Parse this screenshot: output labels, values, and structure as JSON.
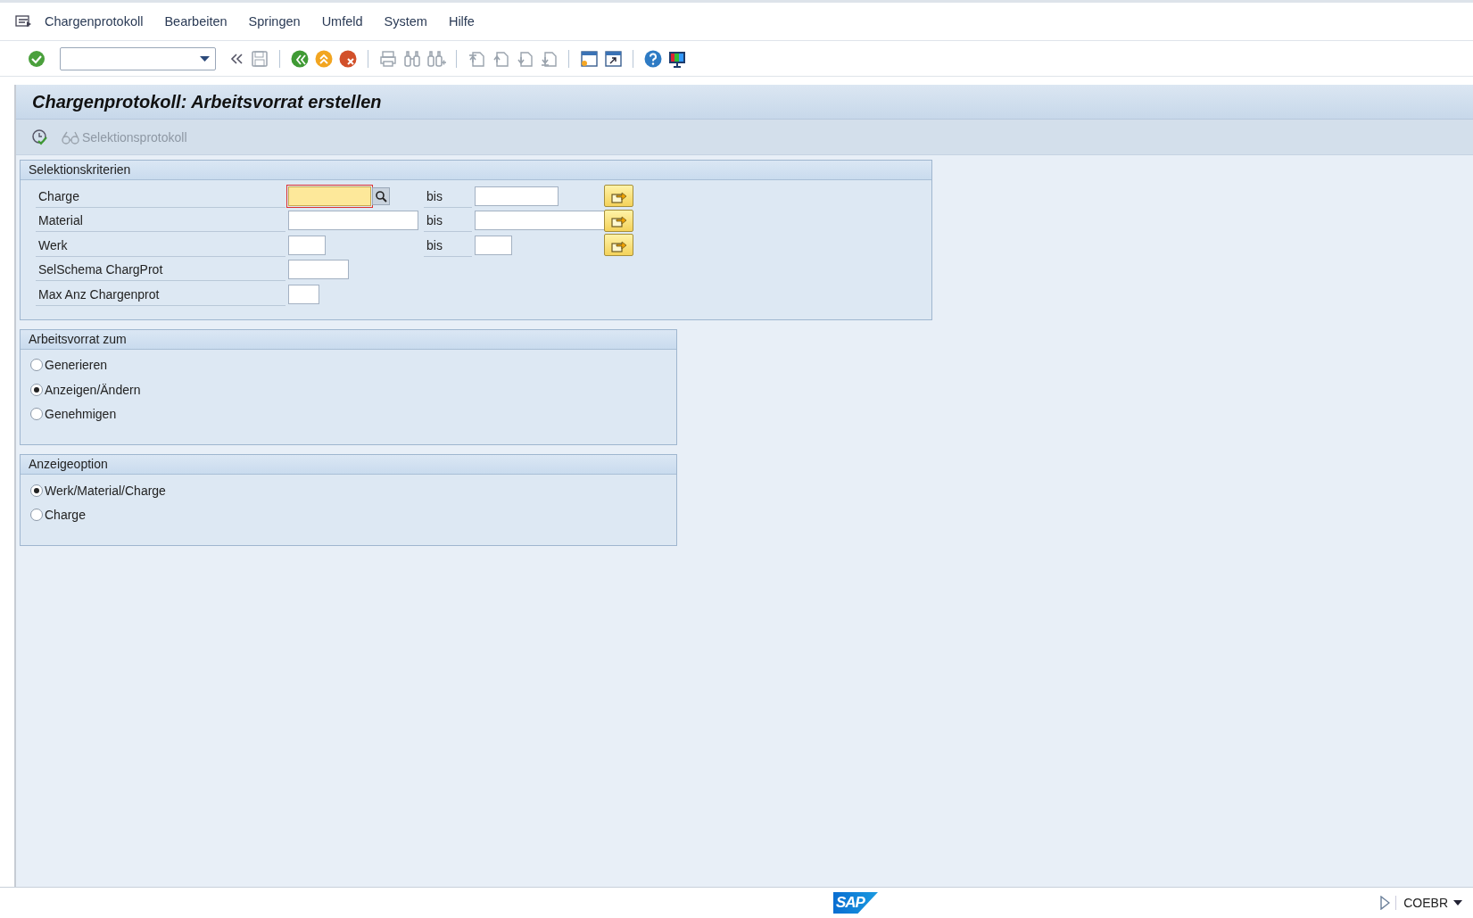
{
  "menu": [
    {
      "label": "Chargenprotokoll"
    },
    {
      "label": "Bearbeiten"
    },
    {
      "label": "Springen"
    },
    {
      "label": "Umfeld"
    },
    {
      "label": "System"
    },
    {
      "label": "Hilfe"
    }
  ],
  "title": "Chargenprotokoll: Arbeitsvorrat erstellen",
  "app_toolbar": {
    "label": "Selektionsprotokoll",
    "disabled": true
  },
  "selection": {
    "title": "Selektionskriterien",
    "rows": [
      {
        "label": "Charge",
        "kind": "range",
        "to_label": "bis",
        "focused": true,
        "search_help": true
      },
      {
        "label": "Material",
        "kind": "range",
        "to_label": "bis",
        "focused": false,
        "search_help": false
      },
      {
        "label": "Werk",
        "kind": "range",
        "to_label": "bis",
        "focused": false,
        "search_help": false
      },
      {
        "label": "SelSchema ChargProt",
        "kind": "single",
        "focused": false,
        "search_help": false
      },
      {
        "label": "Max Anz Chargenprot",
        "kind": "single",
        "focused": false,
        "search_help": false
      }
    ]
  },
  "radio_groups": [
    {
      "title": "Arbeitsvorrat zum",
      "options": [
        {
          "label": "Generieren",
          "selected": false
        },
        {
          "label": "Anzeigen/Ändern",
          "selected": true
        },
        {
          "label": "Genehmigen",
          "selected": false
        }
      ]
    },
    {
      "title": "Anzeigeoption",
      "options": [
        {
          "label": "Werk/Material/Charge",
          "selected": true
        },
        {
          "label": "Charge",
          "selected": false
        }
      ]
    }
  ],
  "status_bar": {
    "logo": "SAP",
    "system": "COEBR"
  }
}
